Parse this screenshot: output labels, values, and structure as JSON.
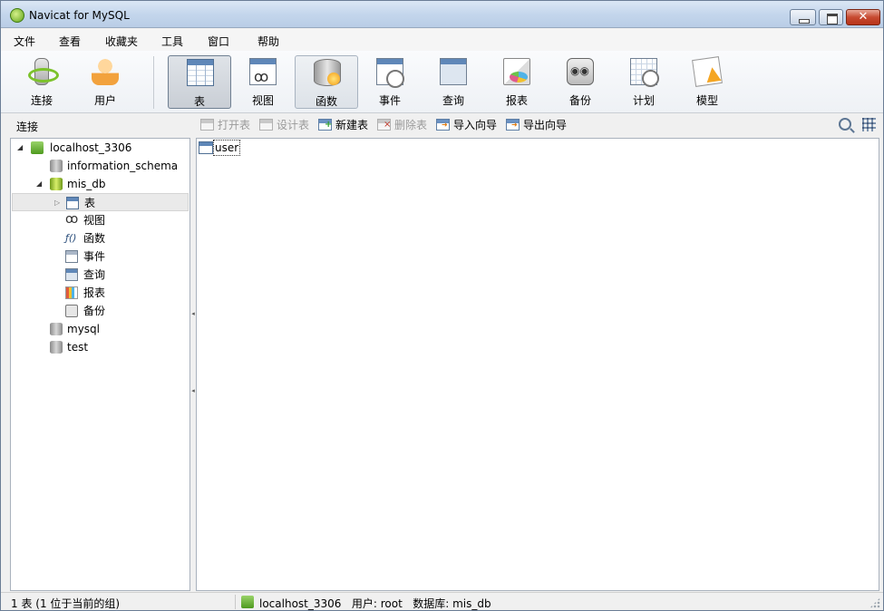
{
  "window": {
    "title": "Navicat for MySQL"
  },
  "menu": [
    "文件",
    "查看",
    "收藏夹",
    "工具",
    "窗口",
    "帮助"
  ],
  "toolbar": {
    "connect": "连接",
    "user": "用户",
    "table": "表",
    "view": "视图",
    "function": "函数",
    "event": "事件",
    "query": "查询",
    "report": "报表",
    "backup": "备份",
    "schedule": "计划",
    "model": "模型"
  },
  "subtoolbar": {
    "panel_title": "连接",
    "open_table": "打开表",
    "design_table": "设计表",
    "new_table": "新建表",
    "delete_table": "删除表",
    "import_wizard": "导入向导",
    "export_wizard": "导出向导"
  },
  "tree": {
    "connection": "localhost_3306",
    "databases": [
      "information_schema",
      "mis_db",
      "mysql",
      "test"
    ],
    "objects": [
      "表",
      "视图",
      "函数",
      "事件",
      "查询",
      "报表",
      "备份"
    ]
  },
  "content": {
    "tables": [
      "user"
    ]
  },
  "status": {
    "count": "1 表 (1 位于当前的组)",
    "connection": "localhost_3306",
    "user": "用户: root",
    "database": "数据库: mis_db"
  },
  "colors": {
    "title_bar": "#c4d6ec",
    "selection": "#eaeaea",
    "close_button": "#c74a31"
  }
}
